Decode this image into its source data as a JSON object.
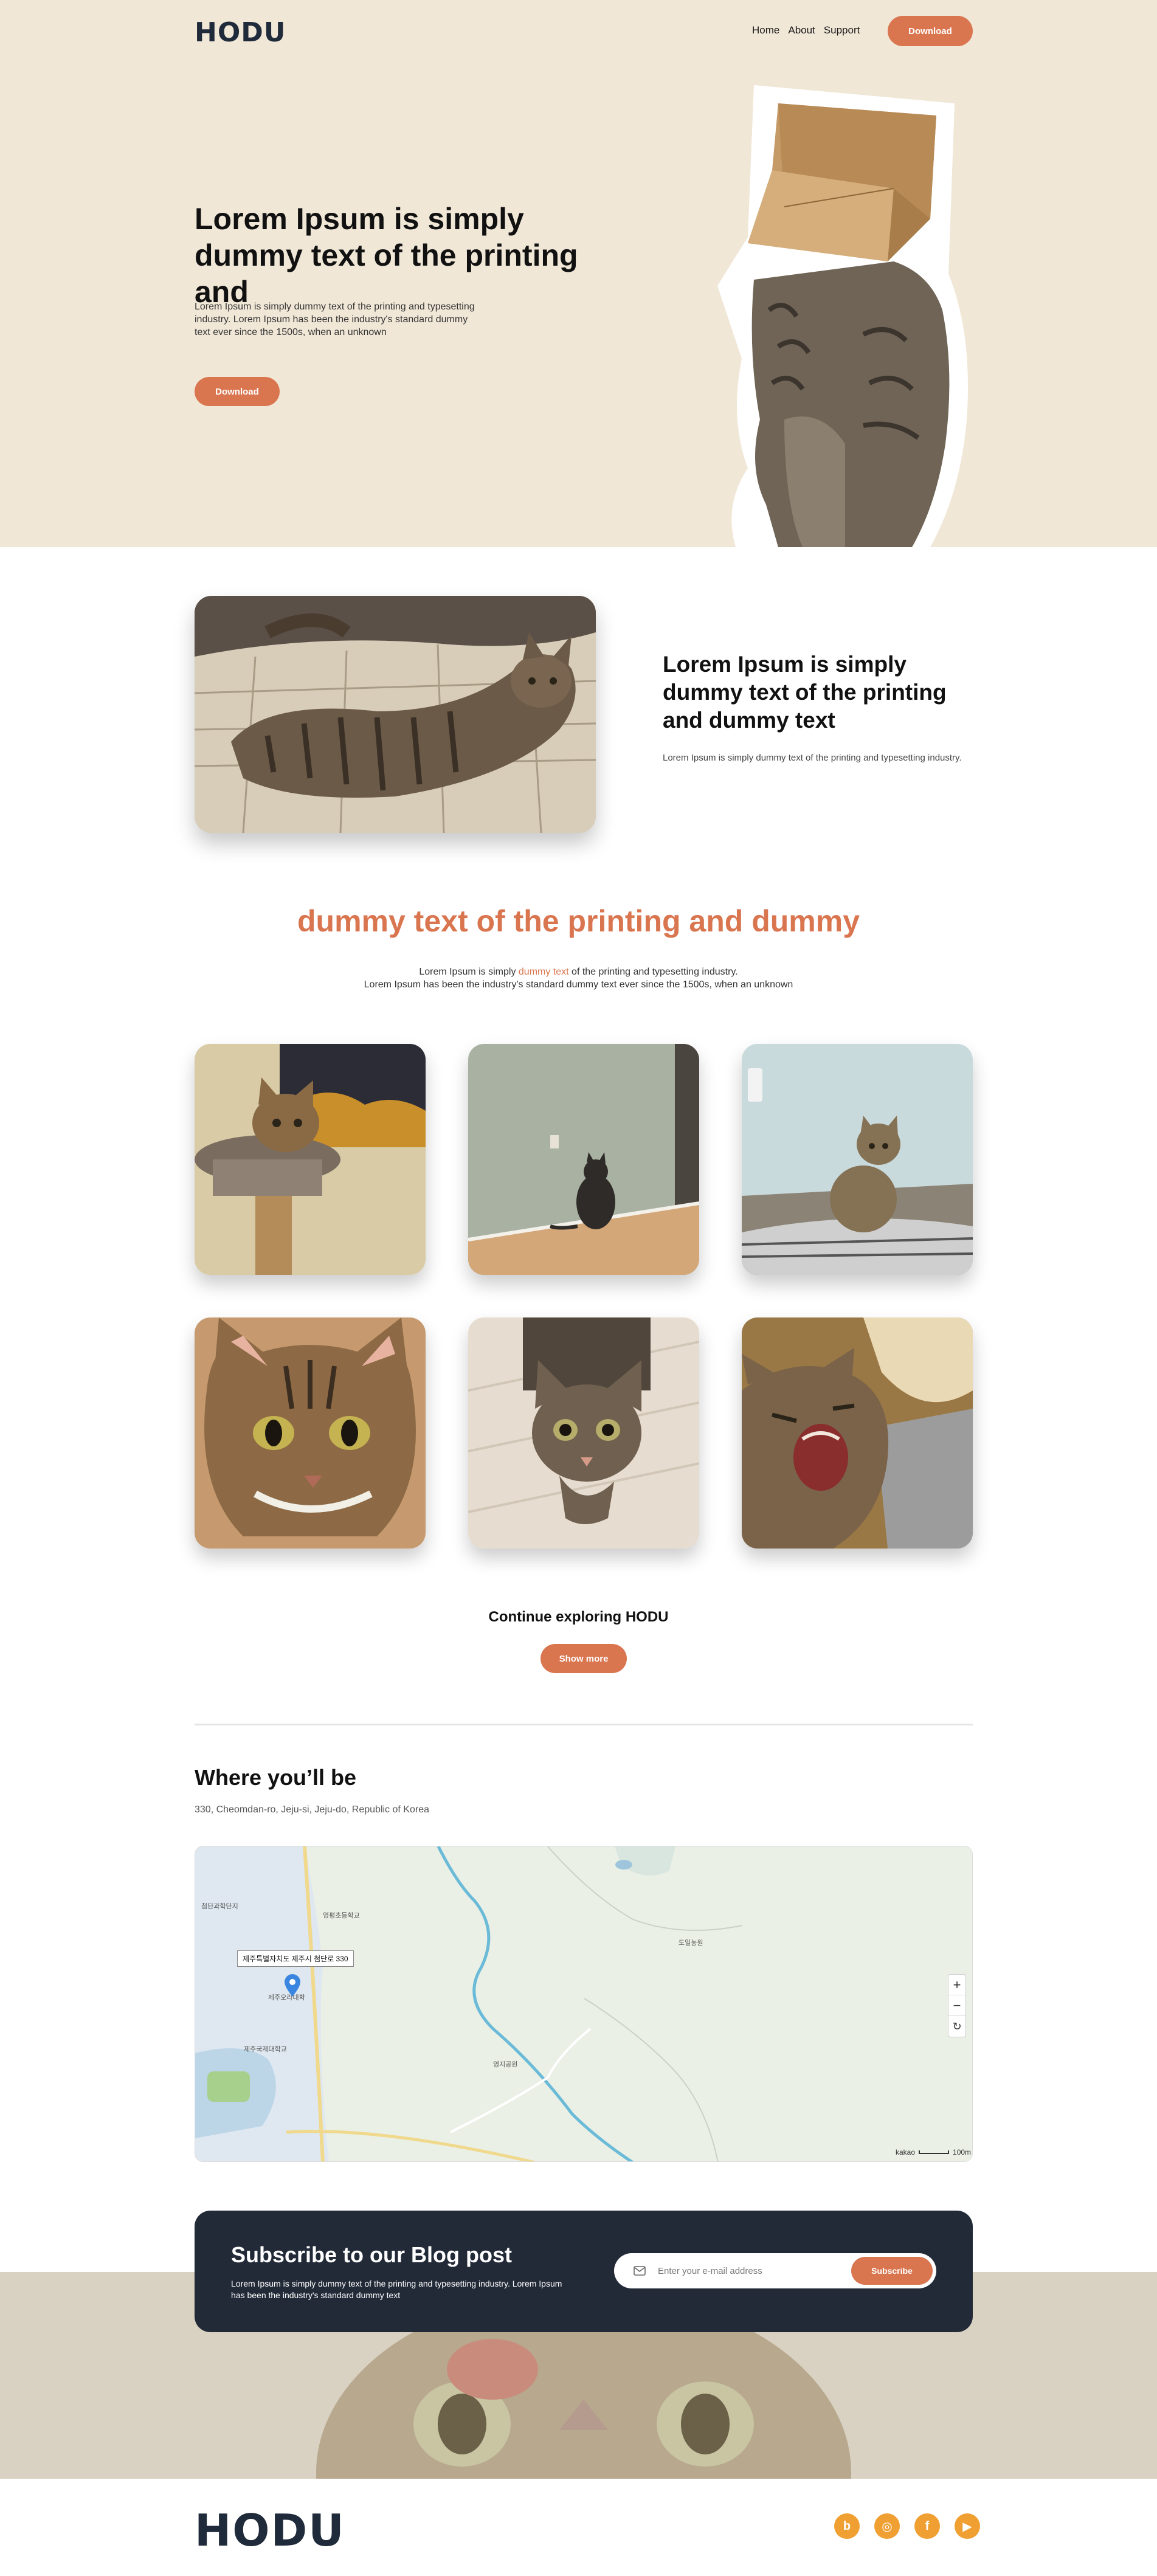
{
  "header": {
    "logo": "HODU",
    "nav": [
      "Home",
      "About",
      "Support"
    ],
    "download_label": "Download"
  },
  "hero": {
    "title": "Lorem Ipsum is simply dummy text of the printing and",
    "text": "Lorem Ipsum is simply dummy text of the printing and typesetting industry. Lorem Ipsum has been the industry's standard dummy text ever since the 1500s, when an unknown",
    "button_label": "Download"
  },
  "feature": {
    "title": "Lorem Ipsum is simply dummy text of the printing and dummy text",
    "text": "Lorem Ipsum is simply dummy text of the printing and typesetting industry."
  },
  "gallery": {
    "title": "dummy text of the printing and dummy",
    "text_before": "Lorem Ipsum is simply ",
    "text_highlight": "dummy text",
    "text_after": " of the printing and typesetting industry.",
    "text_line2": "Lorem Ipsum has been the industry's standard dummy text ever since the 1500s, when an unknown",
    "explore_title": "Continue exploring HODU",
    "show_more_label": "Show more"
  },
  "location": {
    "title": "Where you’ll be",
    "address": "330, Cheomdan-ro, Jeju-si, Jeju-do, Republic of Korea",
    "map": {
      "tooltip": "제주특별자치도 제주시 첨단로 330",
      "labels": [
        "영평초등학교",
        "도일농원",
        "첨단과학단지",
        "제주국제대학교",
        "영지공원",
        "제주오라대학"
      ],
      "attribution": "kakao",
      "scale": "100m",
      "zoom_in": "+",
      "zoom_out": "−",
      "reset": "↻"
    }
  },
  "subscribe": {
    "title": "Subscribe to our Blog post",
    "text": "Lorem Ipsum is simply dummy text of the printing and typesetting industry. Lorem Ipsum has been the industry's standard dummy text",
    "placeholder": "Enter your e-mail address",
    "button_label": "Subscribe"
  },
  "footer": {
    "logo": "HODU",
    "socials": [
      {
        "icon": "blog-icon",
        "glyph": "b"
      },
      {
        "icon": "instagram-icon",
        "glyph": "◎"
      },
      {
        "icon": "facebook-icon",
        "glyph": "f"
      },
      {
        "icon": "youtube-icon",
        "glyph": "▶"
      }
    ]
  },
  "colors": {
    "accent": "#d97650",
    "hero_bg": "#f1e7d7",
    "dark": "#222a38",
    "social": "#f0a032"
  }
}
